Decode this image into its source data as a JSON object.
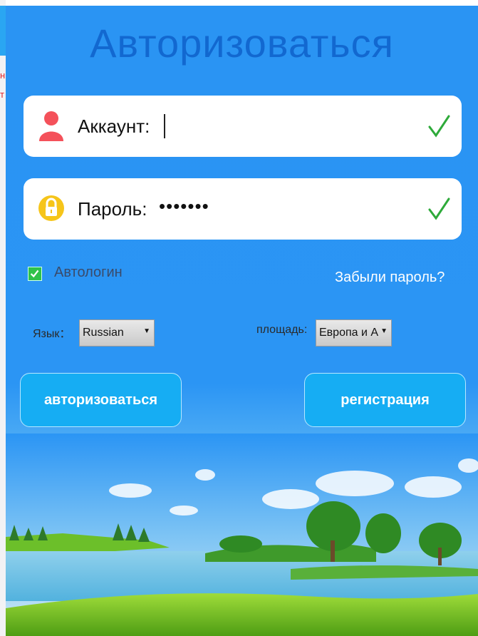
{
  "background_fragments": {
    "line1": "н",
    "line2": "т"
  },
  "title": "Авторизоваться",
  "account": {
    "label": "Аккаунт:",
    "value": ""
  },
  "password": {
    "label": "Пароль:",
    "value": "•••••••"
  },
  "autologin": {
    "label": "Автологин",
    "checked": true
  },
  "forgot_link": "Забыли пароль?",
  "language": {
    "label": "Язык：",
    "selected": "Russian"
  },
  "area": {
    "label": "площадь:",
    "selected": "Европа и А"
  },
  "buttons": {
    "login": "авторизоваться",
    "register": "регистрация"
  },
  "colors": {
    "panel": "#2b95f4",
    "title": "#1268d0",
    "button": "#16adf3",
    "check": "#2eaa3a"
  }
}
